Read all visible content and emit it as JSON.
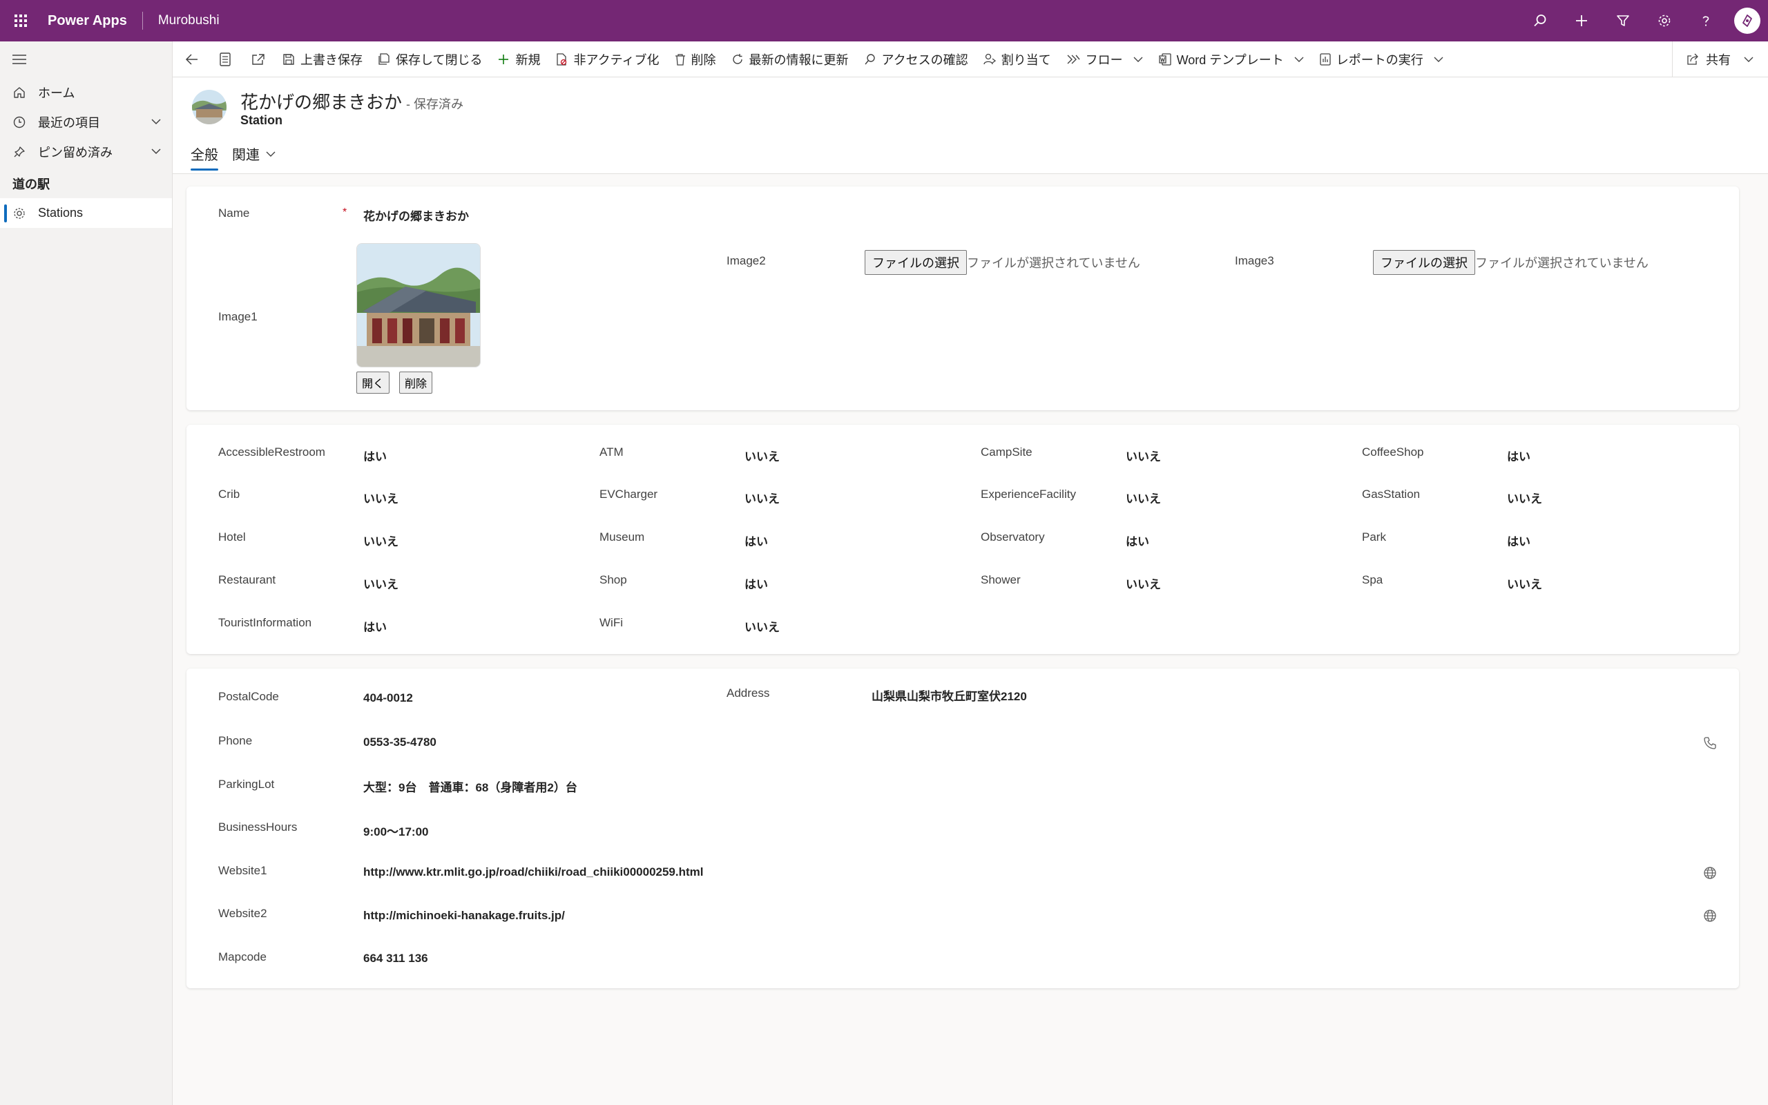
{
  "topbar": {
    "app_title": "Power Apps",
    "env_name": "Murobushi",
    "icons": [
      "search-icon",
      "plus-icon",
      "filter-icon",
      "settings-icon",
      "help-icon",
      "copilot-icon"
    ]
  },
  "sidebar": {
    "items": [
      {
        "label": "ホーム",
        "icon": "home-icon"
      },
      {
        "label": "最近の項目",
        "icon": "clock-icon"
      },
      {
        "label": "ピン留め済み",
        "icon": "pin-icon"
      }
    ],
    "group_label": "道の駅",
    "group_items": [
      {
        "label": "Stations",
        "icon": "puzzle-icon"
      }
    ]
  },
  "commands": {
    "save": "上書き保存",
    "save_close": "保存して閉じる",
    "new": "新規",
    "deactivate": "非アクティブ化",
    "delete": "削除",
    "refresh": "最新の情報に更新",
    "check_access": "アクセスの確認",
    "assign": "割り当て",
    "flow": "フロー",
    "word_template": "Word テンプレート",
    "run_report": "レポートの実行",
    "share": "共有"
  },
  "header": {
    "title": "花かげの郷まきおか",
    "saved_status": "- 保存済み",
    "entity": "Station",
    "tabs": [
      "全般",
      "関連"
    ]
  },
  "general": {
    "name_label": "Name",
    "name_value": "花かげの郷まきおか",
    "image1_label": "Image1",
    "image2_label": "Image2",
    "image3_label": "Image3",
    "open_btn": "開く",
    "delete_btn": "削除",
    "file_button": "ファイルの選択",
    "no_file": "ファイルが選択されていません"
  },
  "facilities": {
    "rows": [
      [
        {
          "label": "AccessibleRestroom",
          "value": "はい"
        },
        {
          "label": "ATM",
          "value": "いいえ"
        },
        {
          "label": "CampSite",
          "value": "いいえ"
        },
        {
          "label": "CoffeeShop",
          "value": "はい"
        }
      ],
      [
        {
          "label": "Crib",
          "value": "いいえ"
        },
        {
          "label": "EVCharger",
          "value": "いいえ"
        },
        {
          "label": "ExperienceFacility",
          "value": "いいえ"
        },
        {
          "label": "GasStation",
          "value": "いいえ"
        }
      ],
      [
        {
          "label": "Hotel",
          "value": "いいえ"
        },
        {
          "label": "Museum",
          "value": "はい"
        },
        {
          "label": "Observatory",
          "value": "はい"
        },
        {
          "label": "Park",
          "value": "はい"
        }
      ],
      [
        {
          "label": "Restaurant",
          "value": "いいえ"
        },
        {
          "label": "Shop",
          "value": "はい"
        },
        {
          "label": "Shower",
          "value": "いいえ"
        },
        {
          "label": "Spa",
          "value": "いいえ"
        }
      ],
      [
        {
          "label": "TouristInformation",
          "value": "はい"
        },
        {
          "label": "WiFi",
          "value": "いいえ"
        }
      ]
    ]
  },
  "details": {
    "postal_label": "PostalCode",
    "postal_value": "404-0012",
    "address_label": "Address",
    "address_value": "山梨県山梨市牧丘町室伏2120",
    "phone_label": "Phone",
    "phone_value": "0553-35-4780",
    "parking_label": "ParkingLot",
    "parking_value": "大型：9台　普通車：68（身障者用2）台",
    "hours_label": "BusinessHours",
    "hours_value": "9:00～17:00",
    "web1_label": "Website1",
    "web1_value": "http://www.ktr.mlit.go.jp/road/chiiki/road_chiiki00000259.html",
    "web2_label": "Website2",
    "web2_value": "http://michinoeki-hanakage.fruits.jp/",
    "mapcode_label": "Mapcode",
    "mapcode_value": "664 311 136"
  },
  "colors": {
    "topbar": "#742774",
    "accent": "#0f6cbd",
    "required": "#c50f1f"
  }
}
